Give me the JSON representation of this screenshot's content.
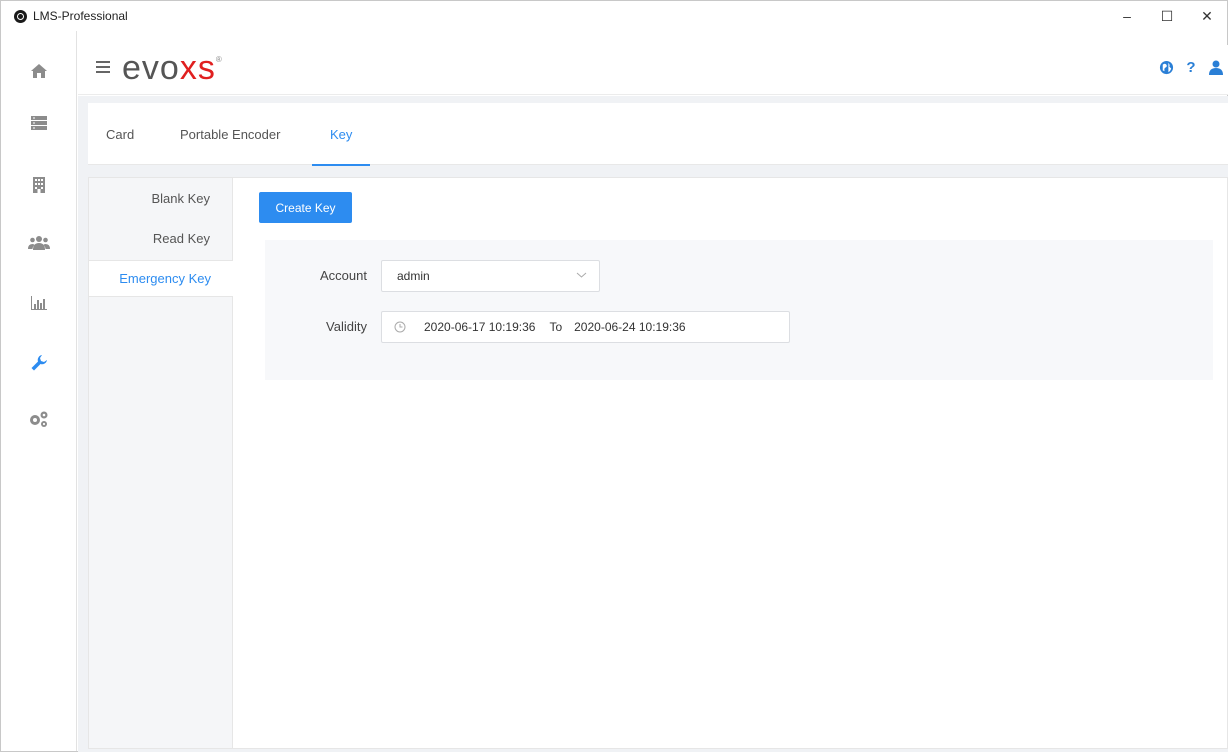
{
  "window": {
    "title": "LMS-Professional",
    "minimize": "–",
    "maximize": "☐",
    "close": "✕"
  },
  "header": {
    "brand_main": "evo",
    "brand_accent": "xs",
    "brand_mark": "®",
    "help": "?"
  },
  "tabs": [
    {
      "label": "Card"
    },
    {
      "label": "Portable Encoder"
    },
    {
      "label": "Key"
    }
  ],
  "submenu": [
    {
      "label": "Blank Key"
    },
    {
      "label": "Read Key"
    },
    {
      "label": "Emergency Key"
    }
  ],
  "form": {
    "create_label": "Create Key",
    "account_label": "Account",
    "account_value": "admin",
    "validity_label": "Validity",
    "validity_start": "2020-06-17 10:19:36",
    "validity_to": "To",
    "validity_end": "2020-06-24 10:19:36"
  },
  "colors": {
    "accent": "#2d8cf0",
    "brand_red": "#e02020",
    "rail_icon": "#8c8c8c",
    "rail_active": "#2d8cf0"
  }
}
